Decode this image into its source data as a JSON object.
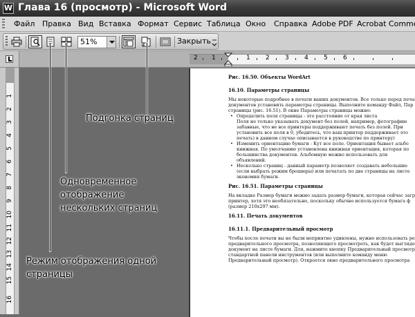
{
  "window": {
    "title": "Глава 16 (просмотр) - Microsoft Word",
    "app_icon": "W"
  },
  "menu": [
    {
      "label": "Файл"
    },
    {
      "label": "Правка"
    },
    {
      "label": "Вид"
    },
    {
      "label": "Вставка"
    },
    {
      "label": "Формат"
    },
    {
      "label": "Сервис"
    },
    {
      "label": "Таблица"
    },
    {
      "label": "Окно"
    },
    {
      "label": "Справка"
    },
    {
      "label": "Adobe PDF"
    },
    {
      "label": "Acrobat Comments"
    }
  ],
  "toolbar": {
    "zoom_value": "51%",
    "close_label": "Закрыть",
    "icons": [
      "print-icon",
      "magnifier-icon",
      "one-page-icon",
      "multiple-pages-icon",
      "view-ruler-icon",
      "shrink-to-fit-icon",
      "full-screen-icon",
      "chevron-icon"
    ]
  },
  "ruler": {
    "h_numbers": [
      "2",
      "1",
      "1",
      "2",
      "3",
      "4",
      "5",
      "6"
    ],
    "v_numbers": [
      "1",
      "2",
      "3",
      "4",
      "5",
      "6",
      "7",
      "8",
      "9",
      "10",
      "11",
      "12",
      "13",
      "14",
      "15",
      "16"
    ]
  },
  "callouts": {
    "fit_pages": "Подгонка страниц",
    "multiple_pages": [
      "Одновременное",
      "отображение",
      "нескольких страниц"
    ],
    "one_page": [
      "Режим отображения одной",
      "страницы"
    ]
  },
  "document": {
    "lines": [
      {
        "kind": "head",
        "text": "Рис. 16.50. Объекты WordArt"
      },
      {
        "kind": "head",
        "text": "16.10. Параметры страницы"
      },
      {
        "kind": "body",
        "text": "Мы некоторые подробнее в печати ваших документов. Все только перед печатью"
      },
      {
        "kind": "body",
        "text": "документов установить параметры страницы. Выполните команду Файл, Пар"
      },
      {
        "kind": "body",
        "text": "страницы (рис. 16.51). В окне Параметры страницы можно:"
      },
      {
        "kind": "bullet",
        "text": "Определить поля страницы - это расстояние от края листа"
      },
      {
        "kind": "cont",
        "text": "Поля не только указывать документ без полей, например, фотографию"
      },
      {
        "kind": "cont",
        "text": "забавные, что не все принтеры поддерживают печать без полей. При"
      },
      {
        "kind": "cont",
        "text": "установить все поля в 0, убедитесь, что ваш принтер поддерживает это"
      },
      {
        "kind": "cont",
        "text": "печать) в данном случае описывается в руководстве по принтеру)"
      },
      {
        "kind": "bullet",
        "text": "Изменить ориентацию бумаги - Кут все поле. Ориентация бывает альбо"
      },
      {
        "kind": "cont",
        "text": "книжная. По умолчанию установлена книжная ориентация, которая по"
      },
      {
        "kind": "cont",
        "text": "большинства документов. Альбомную можно использовать для"
      },
      {
        "kind": "cont",
        "text": "объявлений."
      },
      {
        "kind": "bullet",
        "text": "Несколько страниц - данный параметр позволяет создавать небольшие"
      },
      {
        "kind": "cont",
        "text": "(если выбрать режим брошюры) или печатать по две страницы на листе"
      },
      {
        "kind": "cont",
        "text": "экономия бумаги."
      },
      {
        "kind": "head",
        "text": "Рис. 16.51. Параметры страницы"
      },
      {
        "kind": "body",
        "text": "На вкладке Размер бумаги можно задать размер бумаги, которая сейчас загружена"
      },
      {
        "kind": "body",
        "text": "принтер, хотя это необязательно, поскольку обычно используется бумага ф"
      },
      {
        "kind": "body",
        "text": "(размер 210x297 мм)."
      },
      {
        "kind": "head",
        "text": "16.11. Печать документов"
      },
      {
        "kind": "head",
        "text": "16.11.1. Предварительный просмотр"
      },
      {
        "kind": "body",
        "text": "Чтобы после печати вы не были неприятно удивлены, нужно использовать режим"
      },
      {
        "kind": "body",
        "text": "предварительного просмотра, позволяющего просмотреть, как будет выглядеть"
      },
      {
        "kind": "body",
        "text": "документ на листе бумаги. Для, нажмите кнопку Предварительный просмотр"
      },
      {
        "kind": "body",
        "text": "стандартной панели инструментов (или выполните команду меню"
      },
      {
        "kind": "body",
        "text": "Предварительный просмотр). Откроется окно предварительного просмотра"
      }
    ]
  }
}
